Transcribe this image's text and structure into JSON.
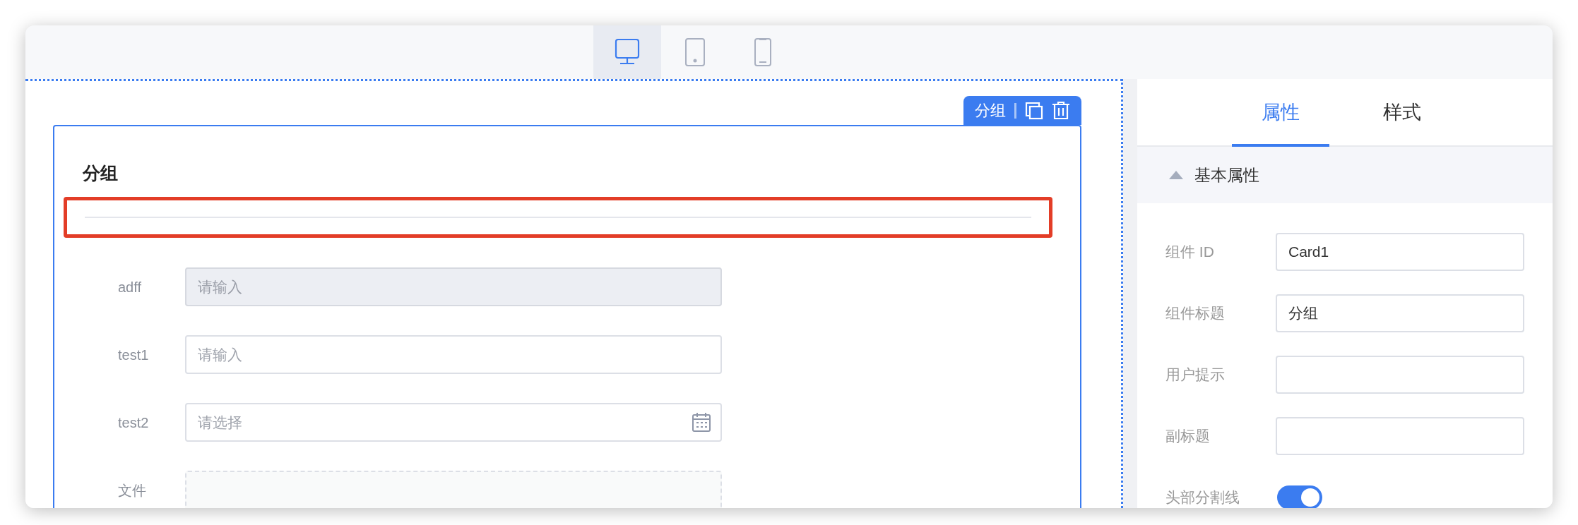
{
  "device_tabs": [
    {
      "kind": "desktop",
      "selected": true
    },
    {
      "kind": "tablet",
      "selected": false
    },
    {
      "kind": "phone",
      "selected": false
    }
  ],
  "card": {
    "toolbar_label": "分组",
    "title": "分组",
    "divider_highlighted": true,
    "fields": [
      {
        "kind": "input",
        "label": "adff",
        "placeholder": "请输入",
        "disabled": true
      },
      {
        "kind": "input",
        "label": "test1",
        "placeholder": "请输入",
        "disabled": false
      },
      {
        "kind": "date",
        "label": "test2",
        "placeholder": "请选择",
        "disabled": false
      },
      {
        "kind": "upload",
        "label": "文件"
      }
    ]
  },
  "panel": {
    "tabs": [
      {
        "label": "属性",
        "selected": true
      },
      {
        "label": "样式",
        "selected": false
      }
    ],
    "section": {
      "title": "基本属性",
      "expanded": true
    },
    "properties": [
      {
        "kind": "text",
        "label": "组件 ID",
        "value": "Card1"
      },
      {
        "kind": "text",
        "label": "组件标题",
        "value": "分组"
      },
      {
        "kind": "text",
        "label": "用户提示"
      },
      {
        "kind": "text",
        "label": "副标题"
      },
      {
        "kind": "switch",
        "label": "头部分割线",
        "on": true
      }
    ]
  }
}
